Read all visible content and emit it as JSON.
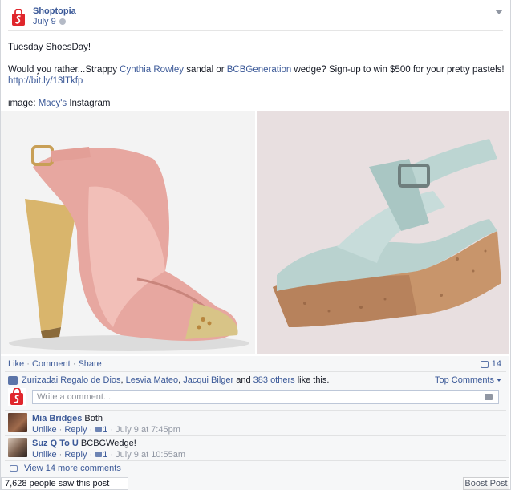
{
  "post": {
    "page_name": "Shoptopia",
    "date": "July 9",
    "text_line1": "Tuesday ShoesDay!",
    "text_line2_parts": [
      "Would you rather...Strappy ",
      "Cynthia Rowley",
      " sandal or ",
      "BCBGeneration",
      " wedge? Sign-up to win $500 for your pretty pastels!"
    ],
    "link": "http://bit.ly/13lTkfp",
    "image_credit_label": "image: ",
    "image_credit_link": "Macy's",
    "image_credit_suffix": " Instagram"
  },
  "actions": {
    "like": "Like",
    "comment": "Comment",
    "share": "Share",
    "sep": " · ",
    "comment_count": "14"
  },
  "likes": {
    "names": [
      "Zurizadai Regalo de Dios",
      "Lesvia Mateo",
      "Jacqui Bilger"
    ],
    "comma": ", ",
    "and": " and ",
    "others": "383 others",
    "suffix": " like this.",
    "sort_label": "Top Comments"
  },
  "composer": {
    "placeholder": "Write a comment..."
  },
  "comments": [
    {
      "author": "Mia Bridges",
      "text": "Both",
      "unlike": "Unlike",
      "reply": "Reply",
      "likes": "1",
      "time": "July 9 at 7:45pm"
    },
    {
      "author": "Suz Q To U",
      "text": "BCBGWedge!",
      "unlike": "Unlike",
      "reply": "Reply",
      "likes": "1",
      "time": "July 9 at 10:55am"
    }
  ],
  "view_more": "View 14 more comments",
  "reach": "7,628 people saw this post",
  "boost_label": "Boost Post",
  "colors": {
    "link": "#3b5998",
    "brand": "#e0262c"
  }
}
